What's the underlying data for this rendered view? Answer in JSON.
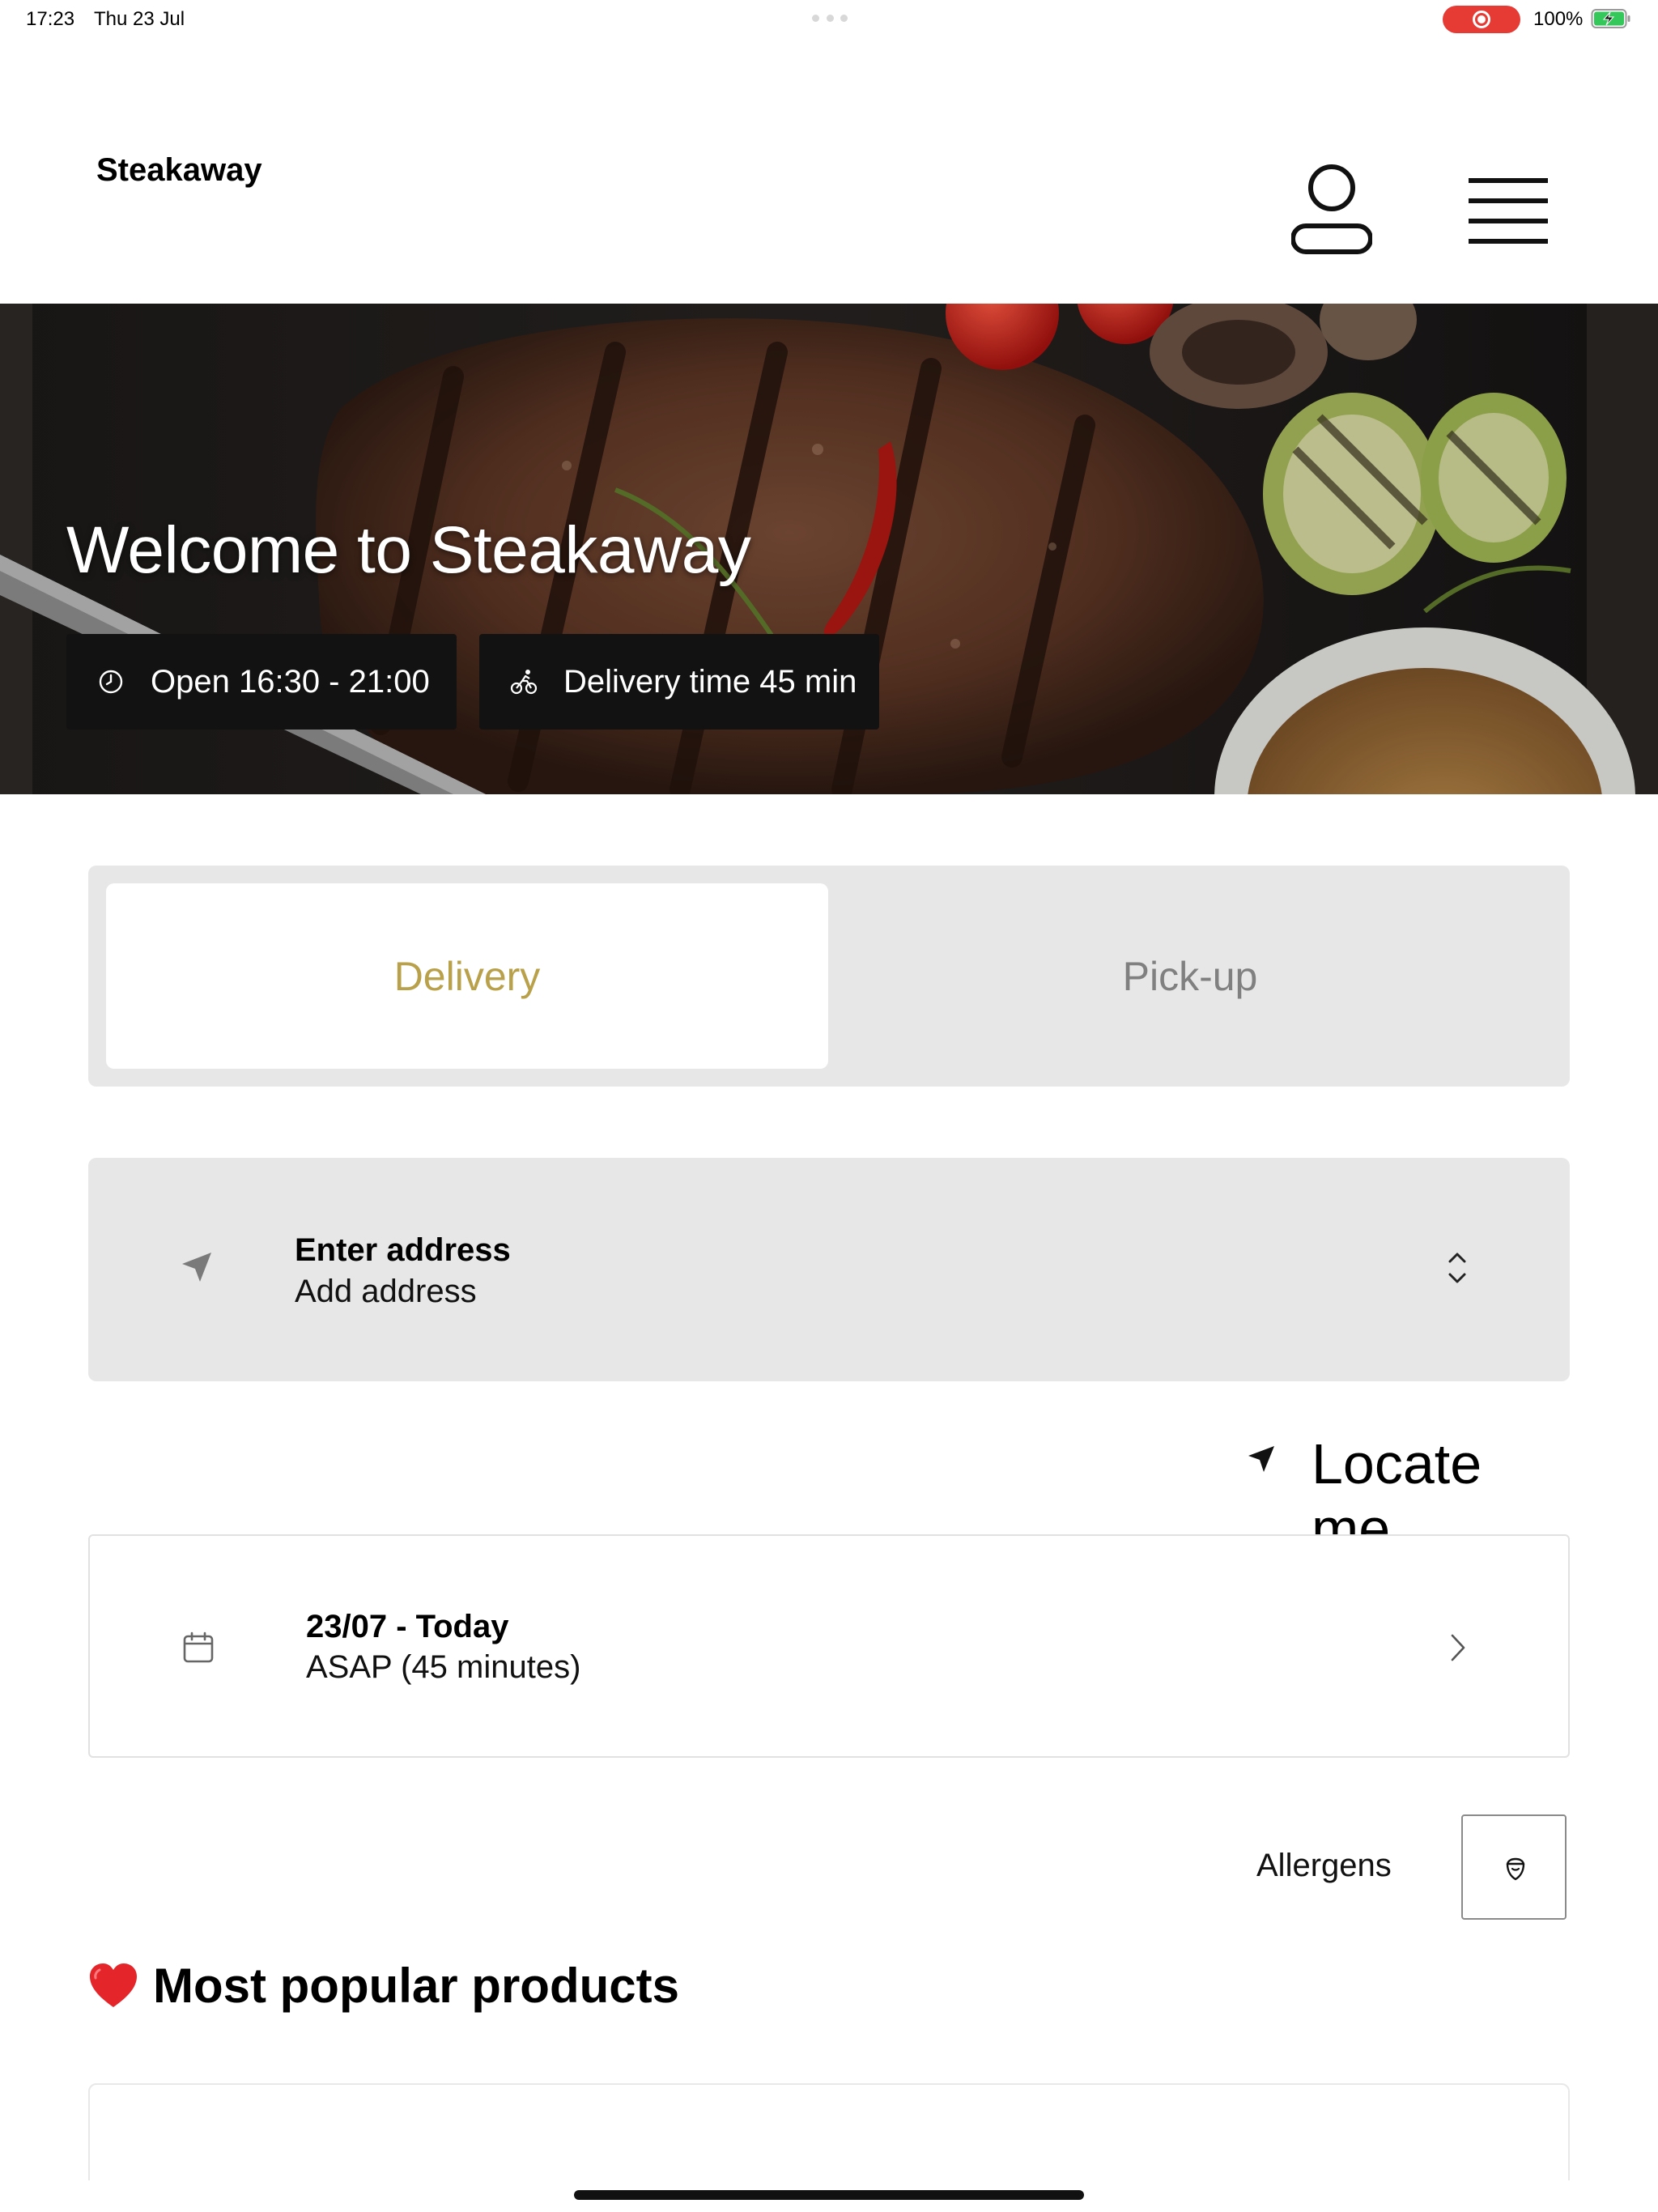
{
  "status_bar": {
    "time": "17:23",
    "date": "Thu 23 Jul",
    "battery": "100%"
  },
  "header": {
    "brand": "Steakaway",
    "account_icon": "user-icon",
    "menu_icon": "hamburger-menu-icon"
  },
  "hero": {
    "title": "Welcome to Steakaway",
    "opening_hours": "Open 16:30 - 21:00",
    "delivery_time": "Delivery time 45 min"
  },
  "order_mode": {
    "options": [
      "Delivery",
      "Pick-up"
    ],
    "selected": "Delivery"
  },
  "address": {
    "title": "Enter address",
    "placeholder": "Add address"
  },
  "locate": {
    "label": "Locate me"
  },
  "schedule": {
    "date": "23/07 - Today",
    "time": "ASAP (45 minutes)"
  },
  "allergens": {
    "label": "Allergens"
  },
  "popular": {
    "emoji": "❤️",
    "title": "Most popular products"
  },
  "colors": {
    "accent_gold": "#b9a04a",
    "control_grey": "#e7e7e7",
    "chip_dark": "#121212",
    "record_red": "#e63a35",
    "battery_green": "#34c759"
  }
}
